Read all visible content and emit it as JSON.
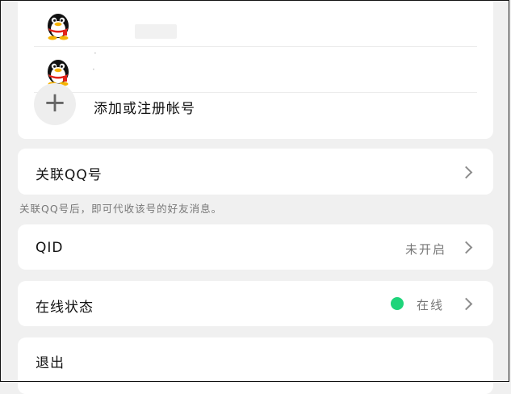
{
  "accounts": [
    {
      "name": "",
      "detail": ""
    },
    {
      "name": "",
      "detail": ""
    }
  ],
  "add_account_label": "添加或注册帐号",
  "link_qq": {
    "label": "关联QQ号",
    "note": "关联QQ号后，即可代收该号的好友消息。"
  },
  "qid": {
    "label": "QID",
    "value": "未开启"
  },
  "online_status": {
    "label": "在线状态",
    "value": "在线",
    "dot_color": "#1ed47a"
  },
  "logout": {
    "label": "退出"
  }
}
